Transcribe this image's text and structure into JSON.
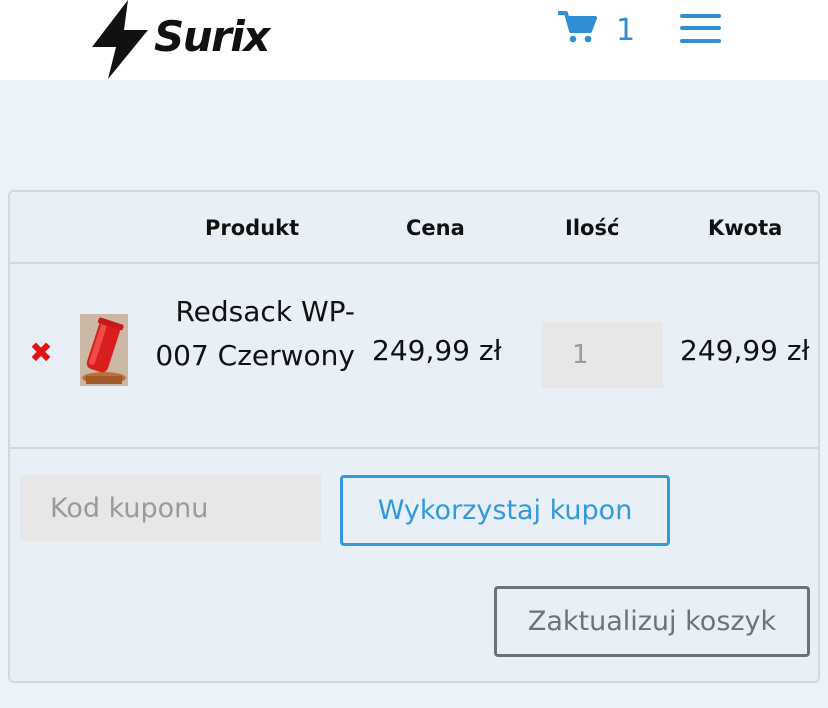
{
  "header": {
    "logo_text": "Surix",
    "cart_count": "1",
    "icons": {
      "logo": "lightning-bolt-icon",
      "cart": "cart-icon",
      "menu": "hamburger-menu-icon"
    },
    "accent_color": "#2f8fd6"
  },
  "cart_table": {
    "columns": [
      "Produkt",
      "Cena",
      "Ilość",
      "Kwota"
    ],
    "rows": [
      {
        "remove_icon": "remove-x-icon",
        "product_name": "Redsack WP-007 Czerwony",
        "price": "249,99 zł",
        "quantity": "1",
        "total": "249,99 zł"
      }
    ]
  },
  "coupon": {
    "placeholder": "Kod kuponu",
    "apply_label": "Wykorzystaj kupon"
  },
  "update_label": "Zaktualizuj koszyk",
  "colors": {
    "remove": "#e41313",
    "apply_button": "#2f9bdc",
    "update_button": "#6b7378",
    "background": "#eaf2fa"
  }
}
